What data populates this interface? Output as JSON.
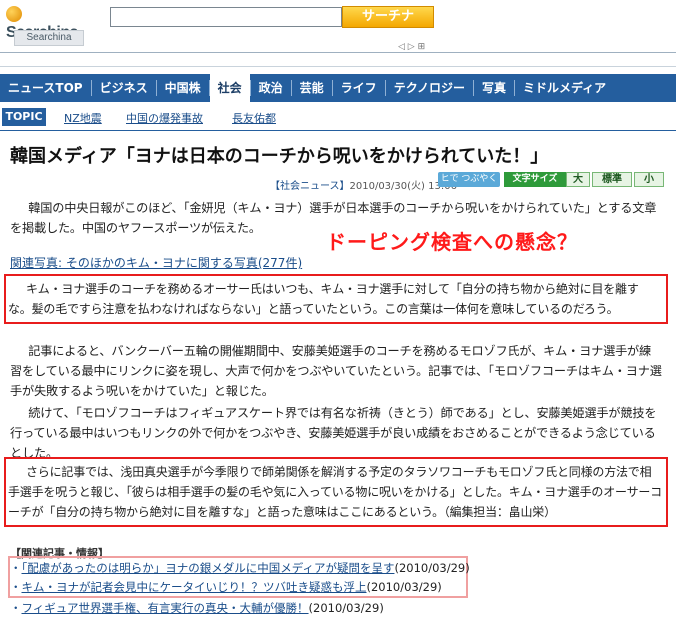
{
  "header": {
    "logo_text": "Searchina",
    "logo_sub": "Searchina",
    "search_value": "",
    "search_button": "サーチナ",
    "arrows": "◁ ▷ ⊞"
  },
  "nav": [
    "ニュースTOP",
    "ビジネス",
    "中国株",
    "社会",
    "政治",
    "芸能",
    "ライフ",
    "テクノロジー",
    "写真",
    "ミドルメディア"
  ],
  "nav_active": "社会",
  "topic": {
    "label": "TOPIC",
    "links": [
      "NZ地震",
      "中国の爆発事故",
      "長友佑都"
    ]
  },
  "article": {
    "title": "韓国メディア「ヨナは日本のコーチから呪いをかけられていた！」",
    "meta_category": "【社会ニュース】",
    "meta_date": "2010/03/30(火) 13:06",
    "tweet_label": "ヒで つぶやく",
    "fontsize_label": "文字サイズ",
    "fontsize_options": [
      "大",
      "標準",
      "小"
    ],
    "overlay": "ドーピング検査への懸念？",
    "p1": "韓国の中央日報がこのほど、「金妍児（キム・ヨナ）選手が日本選手のコーチから呪いをかけられていた」とする文章を掲載した。中国のヤフースポーツが伝えた。",
    "related_photo": "関連写真: そのほかのキム・ヨナに関する写真(277件)",
    "p2": "キム・ヨナ選手のコーチを務めるオーサー氏はいつも、キム・ヨナ選手に対して「自分の持ち物から絶対に目を離すな。髪の毛ですら注意を払わなければならない」と語っていたという。この言葉は一体何を意味しているのだろう。",
    "p3": "記事によると、バンクーバー五輪の開催期間中、安藤美姫選手のコーチを務めるモロゾフ氏が、キム・ヨナ選手が練習をしている最中にリンクに姿を現し、大声で何かをつぶやいていたという。記事では、「モロゾフコーチはキム・ヨナ選手が失敗するよう呪いをかけていた」と報じた。",
    "p4": "続けて、「モロゾフコーチはフィギュアスケート界では有名な祈祷（きとう）師である」とし、安藤美姫選手が競技を行っている最中はいつもリンクの外で何かをつぶやき、安藤美姫選手が良い成績をおさめることができるよう念じているとした。",
    "p5": "さらに記事では、浅田真央選手が今季限りで師弟関係を解消する予定のタラソワコーチもモロゾフ氏と同様の方法で相手選手を呪うと報じ、「彼らは相手選手の髪の毛や気に入っている物に呪いをかける」とした。キム・ヨナ選手のオーサーコーチが「自分の持ち物から絶対に目を離すな」と語った意味はここにあるという。（編集担当：畠山栄）"
  },
  "related": {
    "heading": "【関連記事・情報】",
    "items": [
      {
        "title": "「配慮があったのは明らか」ヨナの銀メダルに中国メディアが疑問を呈す",
        "date": "(2010/03/29)"
      },
      {
        "title": "キム・ヨナが記者会見中にケータイいじり！？ツバ吐き疑惑も浮上",
        "date": "(2010/03/29)"
      },
      {
        "title": "フィギュア世界選手権、有言実行の真央・大輔が優勝！",
        "date": "(2010/03/29)"
      }
    ]
  }
}
